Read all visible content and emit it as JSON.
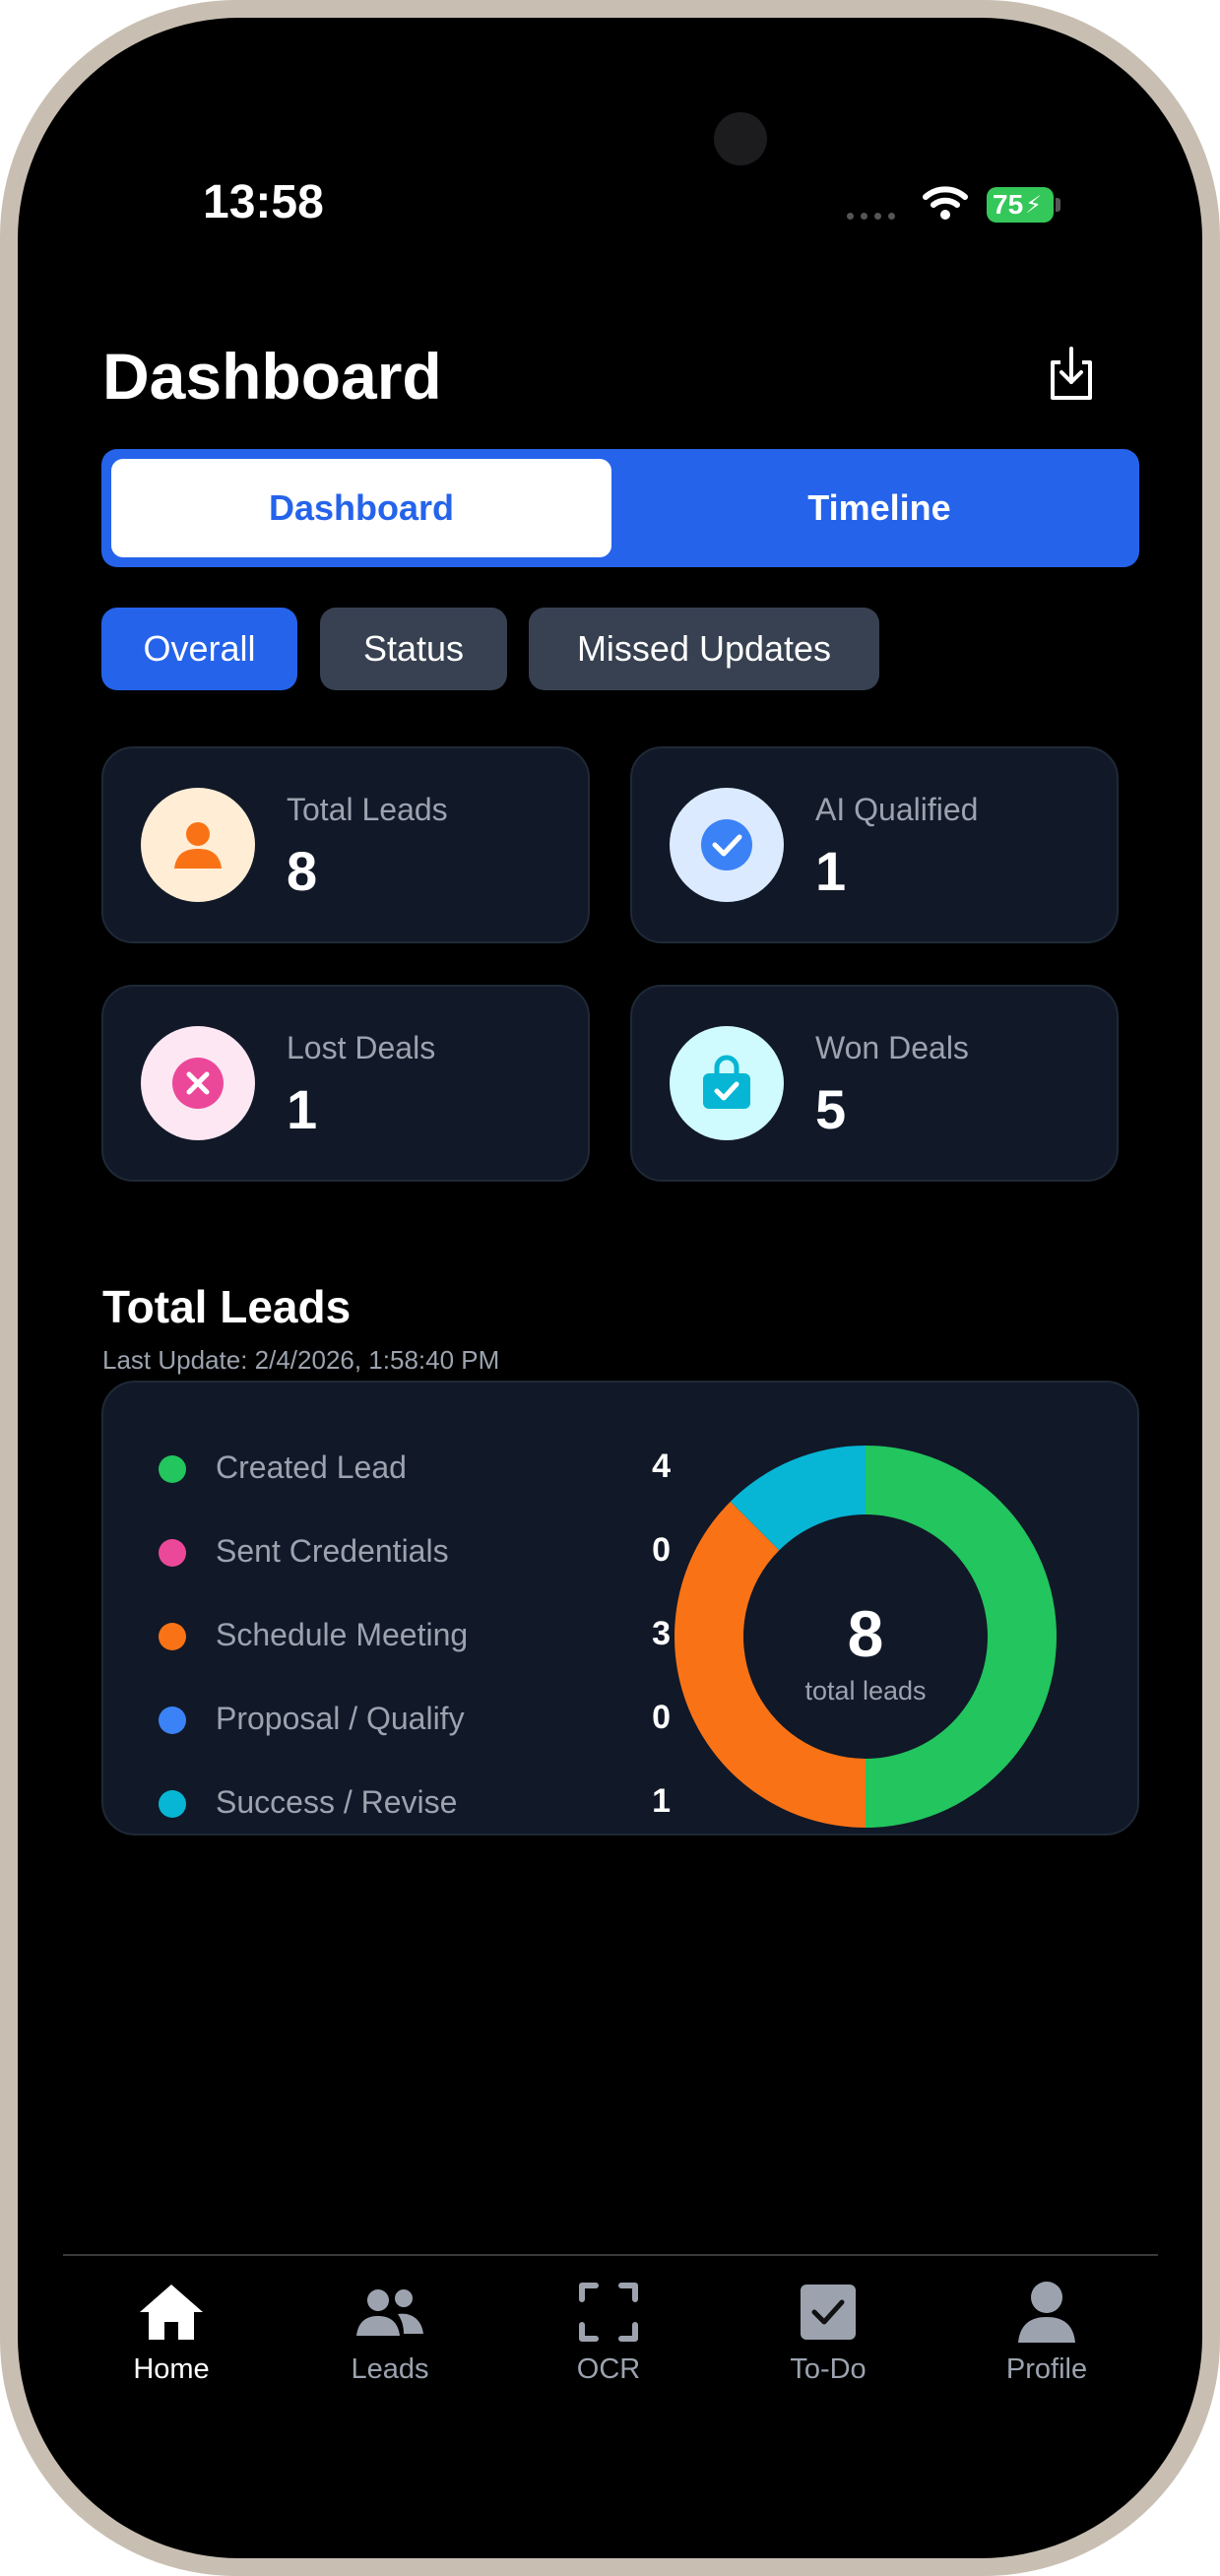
{
  "status_bar": {
    "time": "13:58",
    "battery": "75"
  },
  "header": {
    "title": "Dashboard",
    "export_icon": "download-icon"
  },
  "tabs": [
    {
      "label": "Dashboard",
      "active": true
    },
    {
      "label": "Timeline",
      "active": false
    }
  ],
  "filters": [
    {
      "label": "Overall",
      "active": true
    },
    {
      "label": "Status",
      "active": false
    },
    {
      "label": "Missed Updates",
      "active": false
    }
  ],
  "stats": [
    {
      "label": "Total Leads",
      "value": "8",
      "icon": "person-icon",
      "color": "#f97316"
    },
    {
      "label": "AI Qualified",
      "value": "1",
      "icon": "check-circle-icon",
      "color": "#3b82f6"
    },
    {
      "label": "Lost Deals",
      "value": "1",
      "icon": "x-circle-icon",
      "color": "#ec4899"
    },
    {
      "label": "Won Deals",
      "value": "5",
      "icon": "shopping-bag-check-icon",
      "color": "#06b6d4"
    }
  ],
  "section": {
    "title": "Total Leads",
    "last_update": "Last Update: 2/4/2026, 1:58:40 PM"
  },
  "chart_data": {
    "type": "pie",
    "donut": true,
    "center_value": "8",
    "center_label": "total leads",
    "legend_position": "left",
    "series": [
      {
        "name": "Created Lead",
        "value": 4,
        "color": "#22c55e"
      },
      {
        "name": "Sent Credentials",
        "value": 0,
        "color": "#ec4899"
      },
      {
        "name": "Schedule Meeting",
        "value": 3,
        "color": "#f97316"
      },
      {
        "name": "Proposal / Qualify",
        "value": 0,
        "color": "#3b82f6"
      },
      {
        "name": "Success / Revise",
        "value": 1,
        "color": "#06b6d4"
      }
    ]
  },
  "bottom_nav": [
    {
      "label": "Home",
      "icon": "home-icon",
      "active": true
    },
    {
      "label": "Leads",
      "icon": "users-icon",
      "active": false
    },
    {
      "label": "OCR",
      "icon": "scan-icon",
      "active": false
    },
    {
      "label": "To-Do",
      "icon": "checkbox-icon",
      "active": false
    },
    {
      "label": "Profile",
      "icon": "person-icon",
      "active": false
    }
  ]
}
